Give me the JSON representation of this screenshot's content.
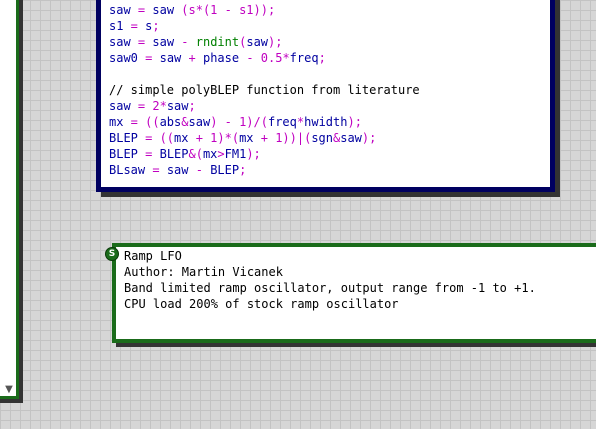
{
  "code_module": {
    "lines": [
      [
        {
          "t": "saw",
          "c": "var"
        },
        {
          "t": " = ",
          "c": "op"
        },
        {
          "t": "saw",
          "c": "var"
        },
        {
          "t": " (s*(1 - s1));",
          "c": "op"
        }
      ],
      [
        {
          "t": "s1",
          "c": "var"
        },
        {
          "t": " = ",
          "c": "op"
        },
        {
          "t": "s",
          "c": "var"
        },
        {
          "t": ";",
          "c": "op"
        }
      ],
      [
        {
          "t": "saw",
          "c": "var"
        },
        {
          "t": " = ",
          "c": "op"
        },
        {
          "t": "saw",
          "c": "var"
        },
        {
          "t": " - ",
          "c": "op"
        },
        {
          "t": "rndint",
          "c": "fn"
        },
        {
          "t": "(",
          "c": "op"
        },
        {
          "t": "saw",
          "c": "var"
        },
        {
          "t": ");",
          "c": "op"
        }
      ],
      [
        {
          "t": "saw0",
          "c": "var"
        },
        {
          "t": " = ",
          "c": "op"
        },
        {
          "t": "saw",
          "c": "var"
        },
        {
          "t": " + ",
          "c": "op"
        },
        {
          "t": "phase",
          "c": "var"
        },
        {
          "t": " - 0.5*",
          "c": "op"
        },
        {
          "t": "freq",
          "c": "var"
        },
        {
          "t": ";",
          "c": "op"
        }
      ],
      [],
      [
        {
          "t": "// simple polyBLEP function from literature",
          "c": "cm"
        }
      ],
      [
        {
          "t": "saw",
          "c": "var"
        },
        {
          "t": " = 2*",
          "c": "op"
        },
        {
          "t": "saw",
          "c": "var"
        },
        {
          "t": ";",
          "c": "op"
        }
      ],
      [
        {
          "t": "mx",
          "c": "var"
        },
        {
          "t": " = ((",
          "c": "op"
        },
        {
          "t": "abs",
          "c": "var"
        },
        {
          "t": "&",
          "c": "op"
        },
        {
          "t": "saw",
          "c": "var"
        },
        {
          "t": ") - 1)/(",
          "c": "op"
        },
        {
          "t": "freq",
          "c": "var"
        },
        {
          "t": "*",
          "c": "op"
        },
        {
          "t": "hwidth",
          "c": "var"
        },
        {
          "t": ");",
          "c": "op"
        }
      ],
      [
        {
          "t": "BLEP",
          "c": "var"
        },
        {
          "t": " = ((",
          "c": "op"
        },
        {
          "t": "mx",
          "c": "var"
        },
        {
          "t": " + 1)*(",
          "c": "op"
        },
        {
          "t": "mx",
          "c": "var"
        },
        {
          "t": " + 1))|(",
          "c": "op"
        },
        {
          "t": "sgn",
          "c": "var"
        },
        {
          "t": "&",
          "c": "op"
        },
        {
          "t": "saw",
          "c": "var"
        },
        {
          "t": ");",
          "c": "op"
        }
      ],
      [
        {
          "t": "BLEP",
          "c": "var"
        },
        {
          "t": " = ",
          "c": "op"
        },
        {
          "t": "BLEP",
          "c": "var"
        },
        {
          "t": "&(",
          "c": "op"
        },
        {
          "t": "mx",
          "c": "var"
        },
        {
          "t": ">",
          "c": "op"
        },
        {
          "t": "FM1",
          "c": "var"
        },
        {
          "t": ");",
          "c": "op"
        }
      ],
      [
        {
          "t": "BLsaw",
          "c": "var"
        },
        {
          "t": " = ",
          "c": "op"
        },
        {
          "t": "saw",
          "c": "var"
        },
        {
          "t": " - ",
          "c": "op"
        },
        {
          "t": "BLEP",
          "c": "var"
        },
        {
          "t": ";",
          "c": "op"
        }
      ]
    ]
  },
  "comment_module": {
    "badge": "S",
    "lines": [
      "Ramp LFO",
      "Author: Martin Vicanek",
      "Band limited ramp oscillator, output range from -1 to +1.",
      "CPU load 200% of stock ramp oscillator"
    ]
  },
  "left_module": {
    "scroll_arrow": "▼"
  },
  "colors": {
    "code_border": "#000060",
    "comment_border": "#1a6b1a",
    "variable": "#0000a0",
    "operator": "#c000c0",
    "function": "#008000",
    "comment": "#000000"
  }
}
